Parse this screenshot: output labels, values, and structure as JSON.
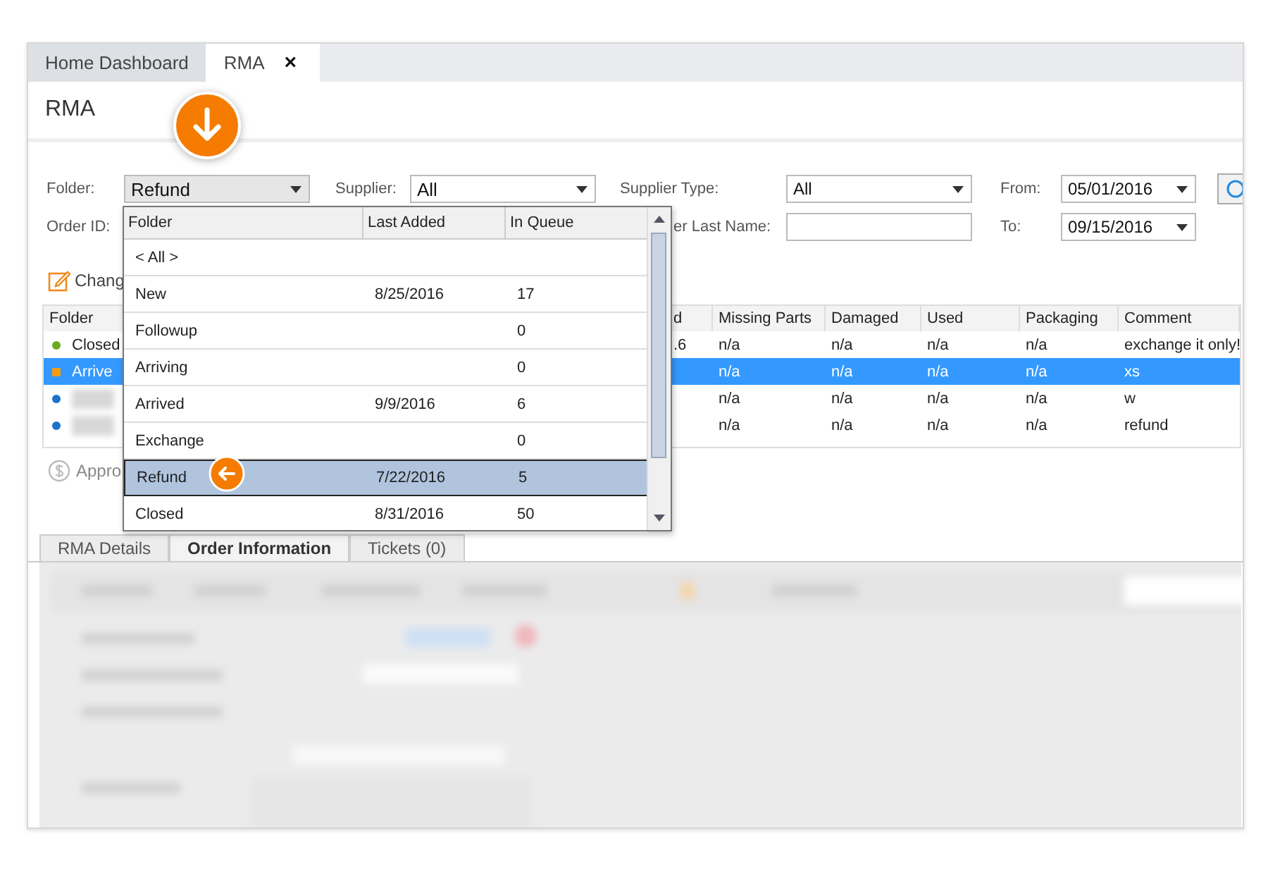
{
  "app_tabs": [
    {
      "label": "Home Dashboard",
      "selected": false
    },
    {
      "label": "RMA",
      "selected": true,
      "close_glyph": "×"
    }
  ],
  "page_title": "RMA",
  "filters": {
    "folder_label": "Folder:",
    "folder_value": "Refund",
    "supplier_label": "Supplier:",
    "supplier_value": "All",
    "supplier_type_label": "Supplier Type:",
    "supplier_type_value": "All",
    "from_label": "From:",
    "from_value": "05/01/2016",
    "order_id_label": "Order ID:",
    "last_name_label": "er Last Name:",
    "to_label": "To:",
    "to_value": "09/15/2016"
  },
  "toolbar": {
    "change_label": "Chang"
  },
  "table": {
    "columns": [
      "Folder",
      "d",
      "Missing Parts",
      "Damaged",
      "Used",
      "Packaging",
      "Comment"
    ],
    "rows": [
      {
        "folder": "Closed",
        "color": "#6aaa1e",
        "column_2": ".6",
        "missing_parts": "n/a",
        "damaged": "n/a",
        "used": "n/a",
        "packaging": "n/a",
        "comment": "exchange it only!",
        "selected": false
      },
      {
        "folder": "Arrive",
        "color": "#f39c12",
        "column_2": "",
        "missing_parts": "n/a",
        "damaged": "n/a",
        "used": "n/a",
        "packaging": "n/a",
        "comment": "xs",
        "selected": true
      },
      {
        "folder": "",
        "color": "#1a73c8",
        "column_2": "",
        "missing_parts": "n/a",
        "damaged": "n/a",
        "used": "n/a",
        "packaging": "n/a",
        "comment": "w",
        "selected": false
      },
      {
        "folder": "",
        "color": "#1a73c8",
        "column_2": "",
        "missing_parts": "n/a",
        "damaged": "n/a",
        "used": "n/a",
        "packaging": "n/a",
        "comment": "refund",
        "selected": false
      }
    ]
  },
  "approve_label": "Appro",
  "detail_tabs": [
    {
      "label": "RMA Details",
      "selected": false
    },
    {
      "label": "Order Information",
      "selected": true
    },
    {
      "label": "Tickets (0)",
      "selected": false
    }
  ],
  "folder_dropdown": {
    "columns": [
      "Folder",
      "Last Added",
      "In Queue"
    ],
    "rows": [
      {
        "folder": "< All >",
        "last_added": "",
        "in_queue": "",
        "selected": false
      },
      {
        "folder": "New",
        "last_added": "8/25/2016",
        "in_queue": "17",
        "selected": false
      },
      {
        "folder": "Followup",
        "last_added": "",
        "in_queue": "0",
        "selected": false
      },
      {
        "folder": "Arriving",
        "last_added": "",
        "in_queue": "0",
        "selected": false
      },
      {
        "folder": "Arrived",
        "last_added": "9/9/2016",
        "in_queue": "6",
        "selected": false
      },
      {
        "folder": "Exchange",
        "last_added": "",
        "in_queue": "0",
        "selected": false
      },
      {
        "folder": "Refund",
        "last_added": "7/22/2016",
        "in_queue": "5",
        "selected": true
      },
      {
        "folder": "Closed",
        "last_added": "8/31/2016",
        "in_queue": "50",
        "selected": false
      }
    ]
  }
}
